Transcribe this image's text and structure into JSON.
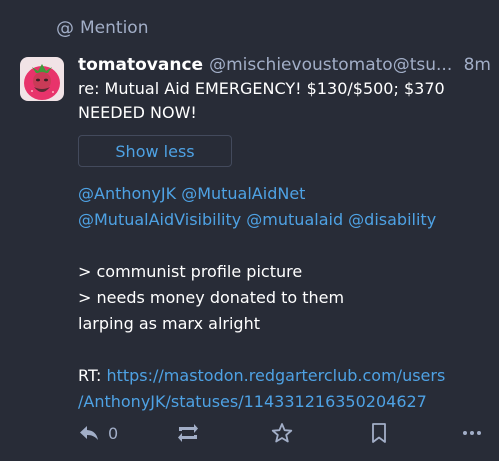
{
  "notification": {
    "type_label": "Mention"
  },
  "status": {
    "display_name": "tomatovance",
    "handle": "@mischievoustomato@tsu...",
    "time": "8m",
    "content_warning": "re: Mutual Aid EMERGENCY! $130/$500; $370 NEEDED NOW!",
    "show_less_label": "Show less",
    "mentions_line1": "@AnthonyJK @MutualAidNet",
    "mentions_line2": "@MutualAidVisibility @mutualaid @disability",
    "quote_line1": "> communist profile picture",
    "quote_line2": "> needs money donated to them",
    "quote_line3": "larping as marx alright",
    "rt_label": "RT: ",
    "rt_link_line1": "https://mastodon.redgarterclub.com/users",
    "rt_link_line2": "/AnthonyJK/statuses/114331216350204627"
  },
  "actions": {
    "reply_count": "0",
    "reply_icon": "reply-icon",
    "boost_icon": "boost-icon",
    "favourite_icon": "star-icon",
    "bookmark_icon": "bookmark-icon",
    "more_icon": "more-icon"
  },
  "colors": {
    "background": "#282c37",
    "text": "#ffffff",
    "secondary": "#a2aec7",
    "link": "#4ea2e4",
    "avatar_bg": "#e8336b"
  }
}
